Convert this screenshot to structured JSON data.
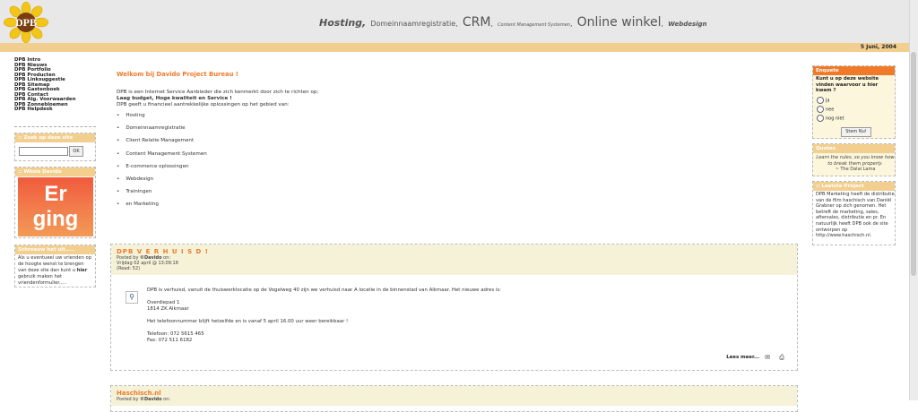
{
  "header": {
    "logo_text": "DPB",
    "slogan": {
      "hosting": "Hosting,",
      "domein": "Domeinnaamregistratie",
      "sep1": ",",
      "crm": "CRM",
      "sep2": ",",
      "cms": "Content Management Systemen",
      "sep3": ",",
      "winkel": "Online winkel",
      "sep4": ",",
      "webdesign": "Webdesign"
    },
    "date": "5 Juni, 2004"
  },
  "leftnav": {
    "items": [
      "DPB Intro",
      "DPB Nieuws",
      "DPB Portfolio",
      "DPB Producten",
      "DPB Linksuggestie",
      "DPB Sitemap",
      "DPB Gastenboek",
      "DPB Contact",
      "DPB Alg. Voorwaarden",
      "DPB Zonnebloemen",
      "DPB Helpdesk"
    ],
    "search_title": ":: Zoek op deze site",
    "search_ok": "OK",
    "who_title": ":: Whois Davido",
    "who_banner_1": "Er",
    "who_banner_2": "ging",
    "shout_title": "Schreeuw het uit.....",
    "shout_text_1": "Als u eventueel uw vrienden op de hoogte wenst te brengen van deze site dan kunt u ",
    "shout_link": "hier",
    "shout_text_2": " gebruik maken het vriendenformulier....."
  },
  "main": {
    "welcome": "Welkom bij Davido Project Bureau !",
    "intro_1": "DPB is een Internet Service Aanbieder die zich kenmerkt door zich te richten op;",
    "intro_2": "Laag budget, Hoge kwaliteit en Service !",
    "intro_3": "DPB geeft u financieel aantrekkelijke oplossingen op het gebied van:",
    "services": [
      "Hosting",
      "Domeinnaamregistratie",
      "Client Relatie Management",
      "Content Management Systemen",
      "E-commerce oplossingen",
      "Webdesign",
      "Trainingen",
      "en Marketing"
    ]
  },
  "news": [
    {
      "title": "DPB V E R H U I S D !",
      "posted_by": "Posted by ",
      "author": "©Davido",
      "posted_on": " on:",
      "date": "Vrijdag 02 april @ 13:09:18",
      "reads": "(Read: 52)",
      "body_1": "DPB is verhuisd, vanuit de thuiswerklocatie op de Vogelweg 40 zijn we verhuisd naar A locatie in de binnenstad van Alkmaar. Het nieuwe adres is:",
      "addr_1": "Overdiepad 1",
      "addr_2": "1814 ZK Alkmaar",
      "body_2": "Het telefoonnummer blijft hetzelfde en is vanaf 5 april 16.00 uur weer bereikbaar !",
      "phone": "Telefoon: 072 5615 465",
      "fax": "Fax: 072 511 6182",
      "readmore": "Lees meer..."
    },
    {
      "title": "Haschisch.nl",
      "posted_by": "Posted by ",
      "author": "©Davido",
      "posted_on": " on:"
    }
  ],
  "right": {
    "poll_title": "Enquete",
    "poll_question": "Kunt u op deze website vinden waarvoor u hier kwam ?",
    "options": [
      "ja",
      "nee",
      "nog niet"
    ],
    "vote": "Stem Nu!",
    "quotes_title": "Quotes",
    "quote": "Learn the rules, so you know how to break them properly.",
    "quote_author": "~ The Dalai Lama",
    "project_title": ":: Laatste Project",
    "project_text": "DPB Marketing heeft de distributie van de film haschisch van Daniël Grabner op zich genomen. Het betreft de marketing, sales, aftersales, distributie en pr. En natuurlijk heeft DPB ook de site ontworpen op http://www.haschisch.nl."
  },
  "colors": {
    "accent_orange": "#f07a2a",
    "header_bar": "#f2cf8f",
    "news_head_bg": "#f5f2d8"
  }
}
